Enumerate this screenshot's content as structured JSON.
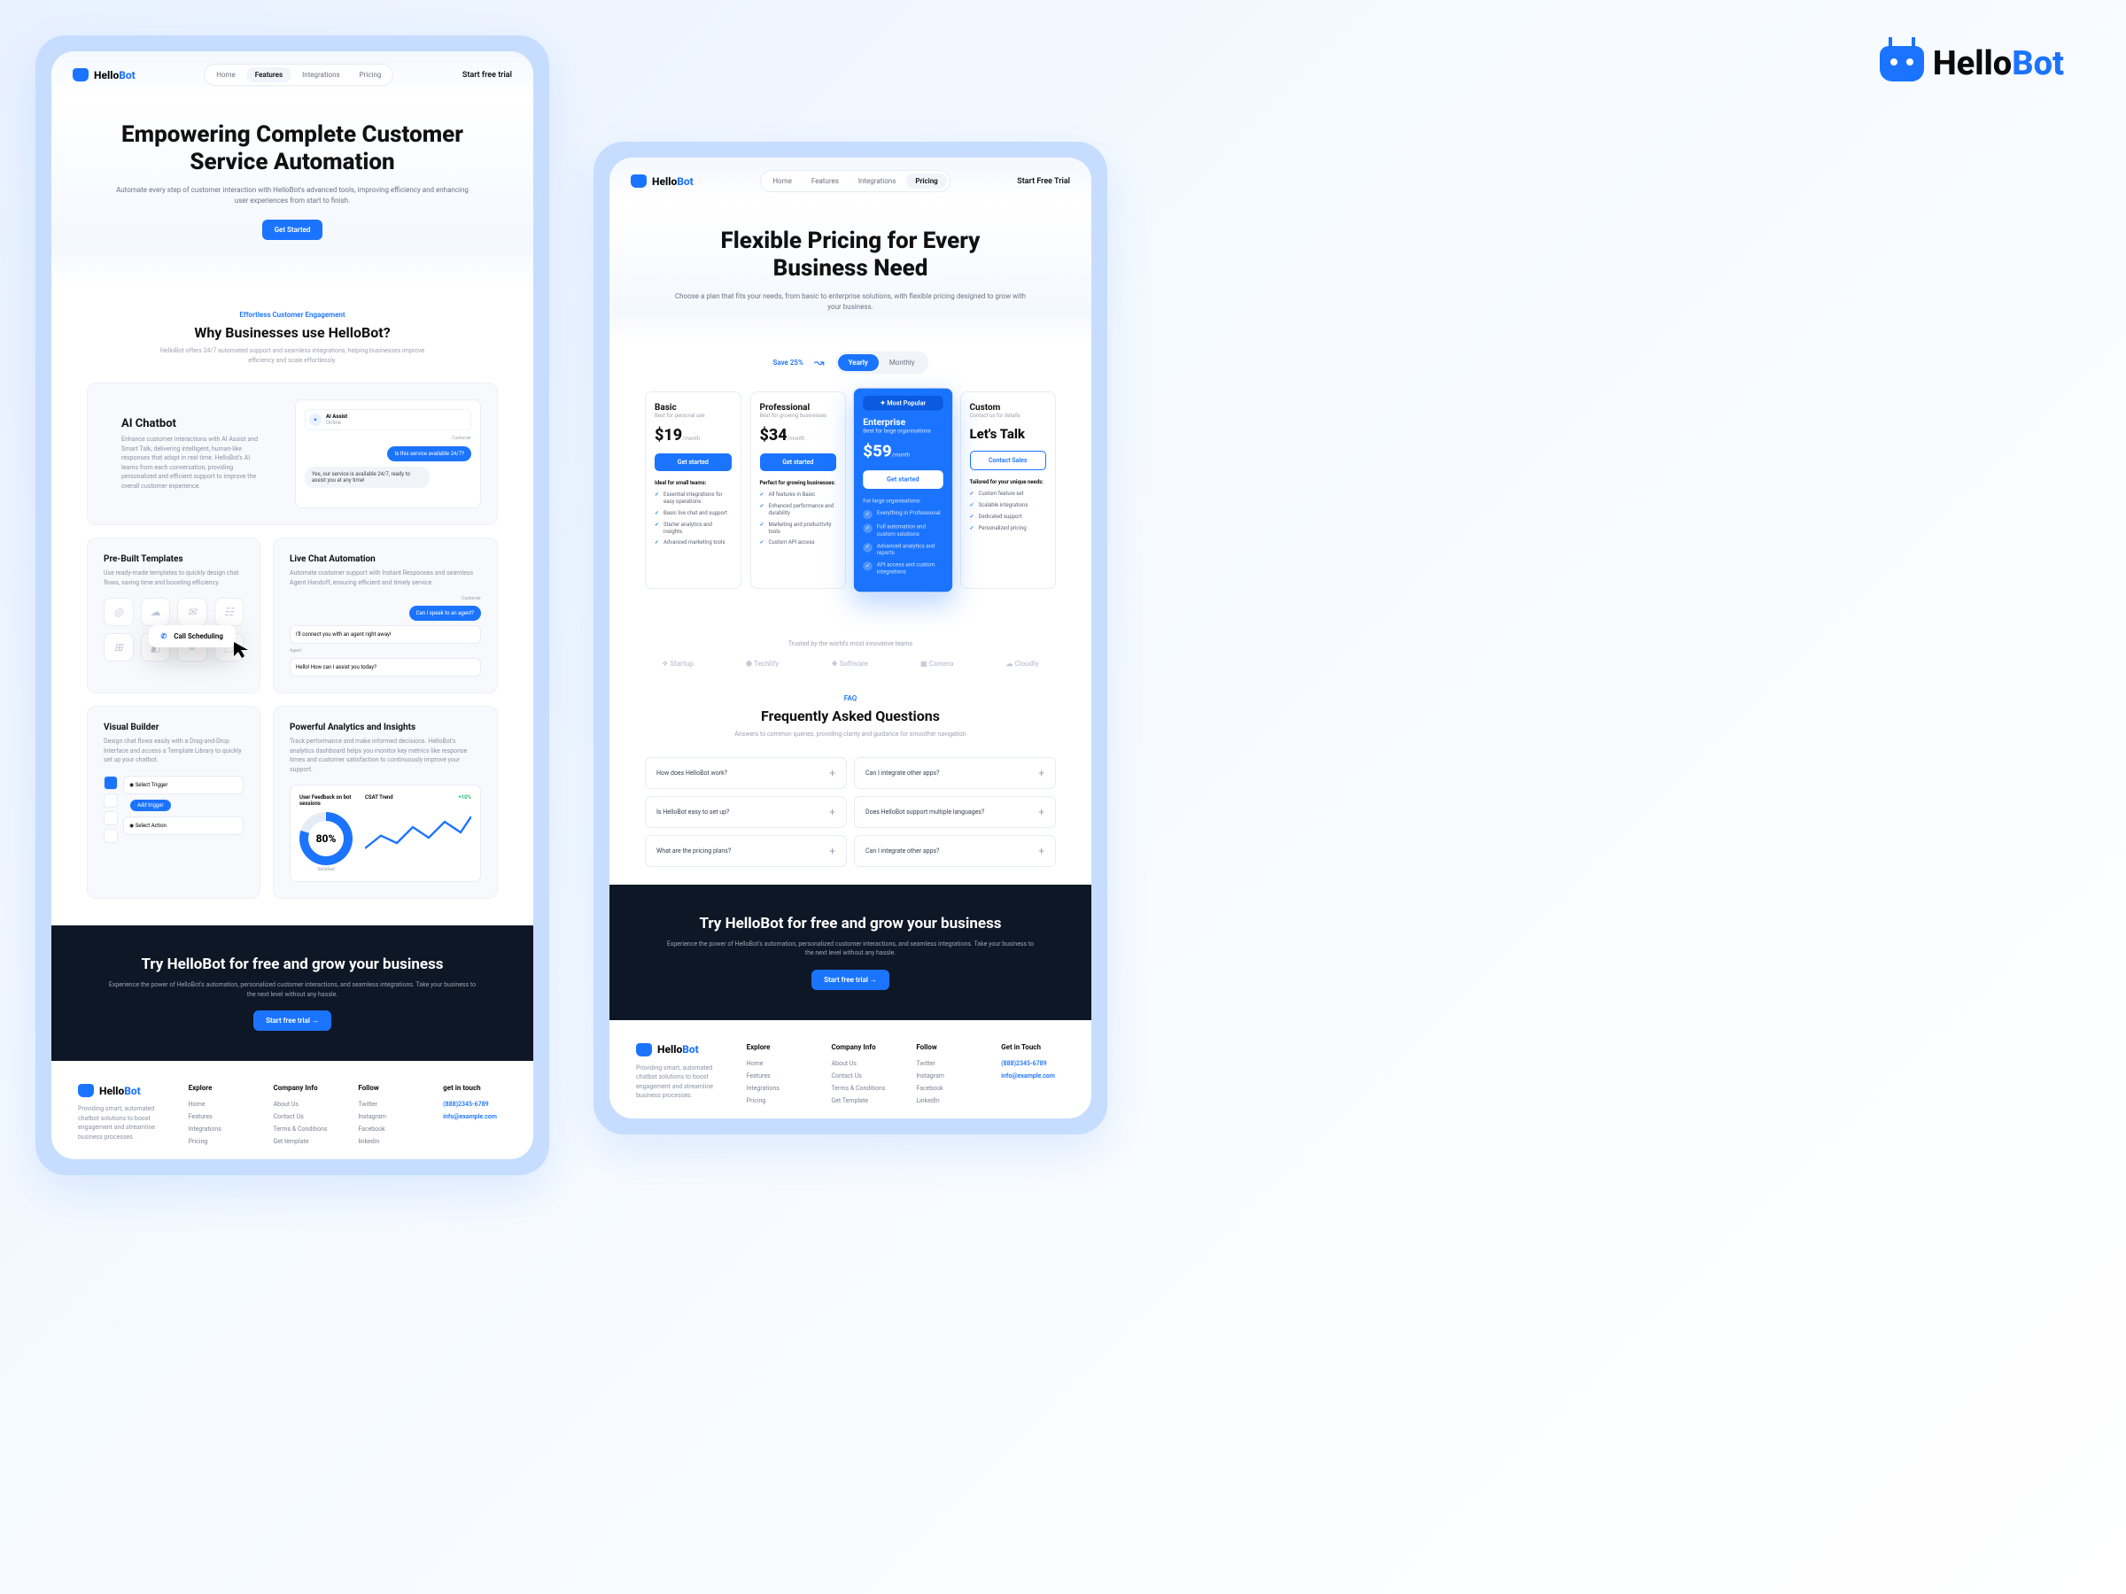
{
  "brand": {
    "name1": "Hello",
    "name2": "Bot"
  },
  "nav": {
    "items": [
      "Home",
      "Features",
      "Integrations",
      "Pricing"
    ],
    "cta": "Start free trial",
    "cta2": "Start Free Trial"
  },
  "left": {
    "hero": {
      "title": "Empowering Complete Customer Service Automation",
      "sub": "Automate every step of customer interaction with HelloBot's advanced tools, improving efficiency and enhancing user experiences from start to finish.",
      "btn": "Get Started"
    },
    "why": {
      "eyebrow": "Effortless Customer Engagement",
      "title": "Why Businesses use HelloBot?",
      "sub": "HelloBot offers 24/7 automated support and seamless integrations, helping businesses improve efficiency and scale effortlessly."
    },
    "chatbot": {
      "title": "AI Chatbot",
      "sub": "Enhance customer interactions with AI Assist and Smart Talk, delivering intelligent, human-like responses that adapt in real time. HelloBot's AI learns from each conversation, providing personalized and efficient support to improve the overall customer experience.",
      "hdr": "AI Assist",
      "status": "Online",
      "u": "Is this service available 24/7?",
      "b": "Yes, our service is available 24/7, ready to assist you at any time!",
      "cust": "Customer"
    },
    "templates": {
      "title": "Pre-Built Templates",
      "sub": "Use ready-made templates to quickly design chat flows, saving time and boosting efficiency.",
      "float": "Call Scheduling"
    },
    "live": {
      "title": "Live Chat Automation",
      "sub": "Automate customer support with Instant Responses and seamless Agent Handoff, ensuring efficient and timely service.",
      "u": "Can I speak to an agent?",
      "b1": "I'll connect you with an agent right away!",
      "b2": "Hello! How can I assist you today?",
      "cust": "Customer",
      "agent": "Agent"
    },
    "builder": {
      "title": "Visual Builder",
      "sub": "Design chat flows easily with a Drag-and-Drop Interface and access a Template Library to quickly set up your chatbot.",
      "n1": "Select Trigger",
      "n2": "Add trigger",
      "n3": "Select Action"
    },
    "analytics": {
      "title": "Powerful Analytics and Insights",
      "sub": "Track performance and make informed decisions. HelloBot's analytics dashboard helps you monitor key metrics like response times and customer satisfaction to continuously improve your support.",
      "t1": "User Feedback on bot sessions",
      "t2": "CSAT Trend",
      "gauge": "80%",
      "sat": "Satisfied",
      "trend": "+10%"
    },
    "footer_phone": "(888)2345-6789",
    "footer_email": "info@example.com",
    "footer_touch": "get in touch"
  },
  "right": {
    "hero": {
      "title": "Flexible Pricing for Every Business Need",
      "sub": "Choose a plan that fits your needs, from basic to enterprise solutions, with flexible pricing designed to grow with your business."
    },
    "toggle": {
      "save": "Save 25%",
      "yearly": "Yearly",
      "monthly": "Monthly"
    },
    "plans": [
      {
        "name": "Basic",
        "sub": "Best for personal use",
        "price": "$19",
        "per": "/month",
        "btn": "Get started",
        "lead": "Ideal for small teams:",
        "items": [
          "Essential integrations for easy operations",
          "Basic live chat and support",
          "Starter analytics and insights",
          "Advanced marketing tools"
        ]
      },
      {
        "name": "Professional",
        "sub": "Best for growing businesses",
        "price": "$34",
        "per": "/month",
        "btn": "Get started",
        "lead": "Perfect for growing businesses:",
        "items": [
          "All features in Basic",
          "Enhanced performance and durability",
          "Marketing and productivity tools",
          "Custom API access"
        ]
      },
      {
        "name": "Enterprise",
        "sub": "Best for large organisations",
        "price": "$59",
        "per": "/month",
        "btn": "Get started",
        "badge": "✦ Most Popular",
        "lead": "For large organisations:",
        "items": [
          "Everything in Professional",
          "Full automation and custom solutions",
          "Advanced analytics and reports",
          "API access and custom integrations"
        ]
      },
      {
        "name": "Custom",
        "sub": "Contact us for details",
        "price": "Let's Talk",
        "per": "",
        "btn": "Contact Sales",
        "lead": "Tailored for your unique needs:",
        "items": [
          "Custom feature set",
          "Scalable integrations",
          "Dedicated support",
          "Personalized pricing"
        ]
      }
    ],
    "trusted": "Trusted by the world's most innovative teams",
    "logos": [
      "Startup",
      "Techlify",
      "Software",
      "Camera",
      "Cloudly"
    ],
    "faq": {
      "eyebrow": "FAQ",
      "title": "Frequently Asked Questions",
      "sub": "Answers to common queries, providing clarity and guidance for smoother navigation",
      "items": [
        "How does HelloBot work?",
        "Can I integrate other apps?",
        "Is HelloBot easy to set up?",
        "Does HelloBot support multiple languages?",
        "What are the pricing plans?",
        "Can I integrate other apps?"
      ]
    },
    "footer_touch": "Get in Touch"
  },
  "cta": {
    "title": "Try HelloBot for free and grow your business",
    "sub": "Experience the power of HelloBot's automation, personalized customer interactions, and seamless integrations. Take your business to the next level without any hassle.",
    "btn": "Start free trial  →"
  },
  "footer": {
    "about": "Providing smart, automated chatbot solutions to boost engagement and streamline business processes.",
    "cols": [
      {
        "h": "Explore",
        "links": [
          "Home",
          "Features",
          "Integrations",
          "Pricing"
        ]
      },
      {
        "h": "Company Info",
        "links": [
          "About Us",
          "Contact Us",
          "Terms & Conditions",
          "Get template"
        ]
      },
      {
        "h": "Follow",
        "links": [
          "Twitter",
          "Instagram",
          "Facebook",
          "linkedin"
        ]
      }
    ],
    "cols2": [
      {
        "h": "Explore",
        "links": [
          "Home",
          "Features",
          "Integrations",
          "Pricing"
        ]
      },
      {
        "h": "Company Info",
        "links": [
          "About Us",
          "Contact Us",
          "Terms & Conditions",
          "Get Template"
        ]
      },
      {
        "h": "Follow",
        "links": [
          "Twitter",
          "Instagram",
          "Facebook",
          "LinkedIn"
        ]
      }
    ]
  }
}
